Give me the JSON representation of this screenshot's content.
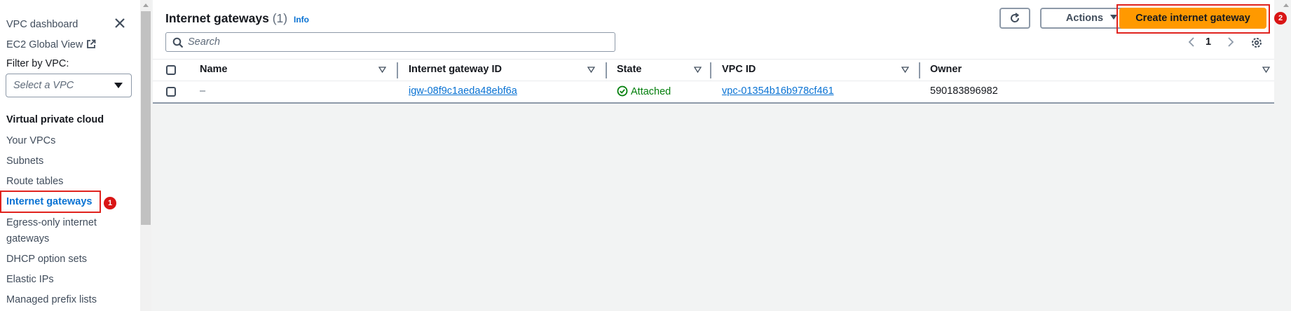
{
  "sidebar": {
    "vpc_dashboard": "VPC dashboard",
    "ec2_global_view": "EC2 Global View",
    "filter_label": "Filter by VPC:",
    "filter_placeholder": "Select a VPC",
    "section_title": "Virtual private cloud",
    "items": [
      {
        "label": "Your VPCs"
      },
      {
        "label": "Subnets"
      },
      {
        "label": "Route tables"
      },
      {
        "label": "Internet gateways"
      },
      {
        "label": "Egress-only internet"
      },
      {
        "label": "gateways"
      },
      {
        "label": "DHCP option sets"
      },
      {
        "label": "Elastic IPs"
      },
      {
        "label": "Managed prefix lists"
      }
    ],
    "badge": "1"
  },
  "header": {
    "title": "Internet gateways",
    "count": "(1)",
    "info": "Info",
    "actions_label": "Actions",
    "create_label": "Create internet gateway",
    "create_badge": "2"
  },
  "search": {
    "placeholder": "Search"
  },
  "pagination": {
    "page": "1"
  },
  "table": {
    "columns": [
      "Name",
      "Internet gateway ID",
      "State",
      "VPC ID",
      "Owner"
    ],
    "rows": [
      {
        "name": "–",
        "gateway_id": "igw-08f9c1aeda48ebf6a",
        "state": "Attached",
        "vpc_id": "vpc-01354b16b978cf461",
        "owner": "590183896982"
      }
    ]
  },
  "colors": {
    "accent": "#0972d3",
    "primary_button": "#ff9900",
    "highlight_border": "#e0231e",
    "success": "#037f0c"
  }
}
